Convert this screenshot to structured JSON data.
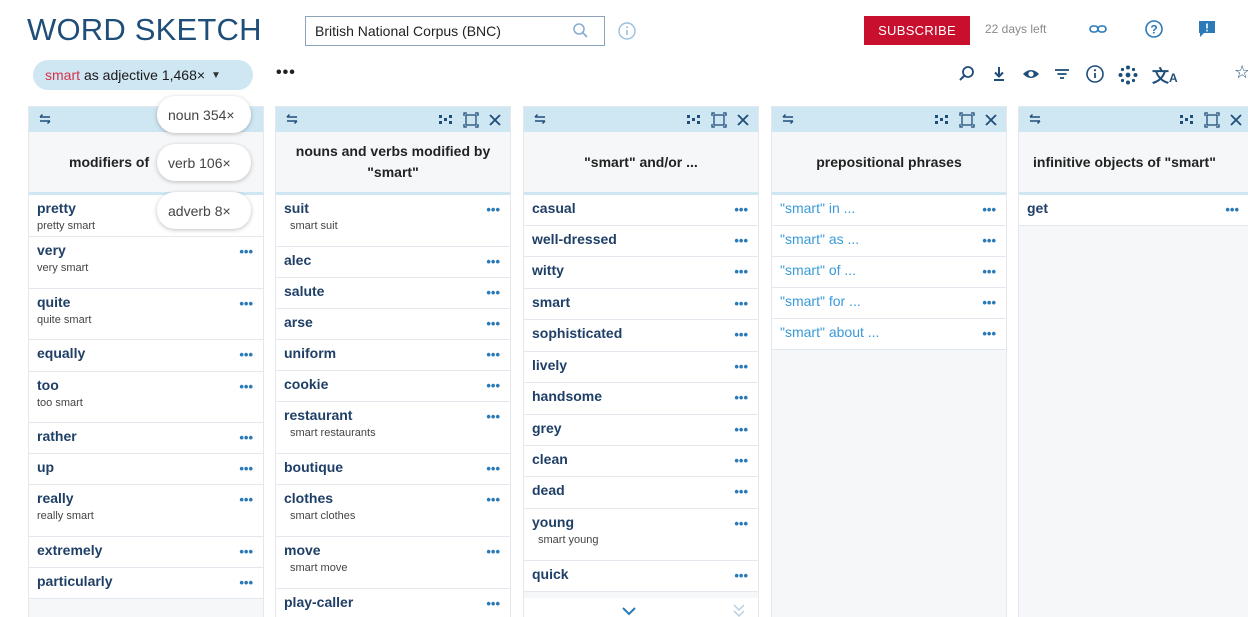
{
  "header": {
    "logo": "WORD SKETCH",
    "corpus": "British National Corpus (BNC)",
    "subscribe": "SUBSCRIBE",
    "days_left": "22 days left"
  },
  "query": {
    "keyword": "smart",
    "rest": "as adjective 1,468×",
    "more": "•••"
  },
  "pos_options": [
    {
      "label": "noun 354×"
    },
    {
      "label": "verb 106×"
    },
    {
      "label": "adverb 8×"
    }
  ],
  "columns": [
    {
      "title": "modifiers of",
      "rows": [
        {
          "w": "pretty",
          "ex": "pretty smart",
          "dots": "•••"
        },
        {
          "w": "very",
          "ex": "very smart",
          "dots": "•••"
        },
        {
          "w": "quite",
          "ex": "quite smart",
          "dots": "•••"
        },
        {
          "w": "equally",
          "ex": "",
          "dots": "•••"
        },
        {
          "w": "too",
          "ex": "too smart",
          "dots": "•••"
        },
        {
          "w": "rather",
          "ex": "",
          "dots": "•••"
        },
        {
          "w": "up",
          "ex": "",
          "dots": "•••"
        },
        {
          "w": "really",
          "ex": "really smart",
          "dots": "•••"
        },
        {
          "w": "extremely",
          "ex": "",
          "dots": "•••"
        },
        {
          "w": "particularly",
          "ex": "",
          "dots": "•••"
        }
      ]
    },
    {
      "title": "nouns and verbs modified by \"smart\"",
      "rows": [
        {
          "w": "suit",
          "ex": "smart suit",
          "dots": "•••"
        },
        {
          "w": "alec",
          "ex": "",
          "dots": "•••"
        },
        {
          "w": "salute",
          "ex": "",
          "dots": "•••"
        },
        {
          "w": "arse",
          "ex": "",
          "dots": "•••"
        },
        {
          "w": "uniform",
          "ex": "",
          "dots": "•••"
        },
        {
          "w": "cookie",
          "ex": "",
          "dots": "•••"
        },
        {
          "w": "restaurant",
          "ex": "smart restaurants",
          "dots": "•••"
        },
        {
          "w": "boutique",
          "ex": "",
          "dots": "•••"
        },
        {
          "w": "clothes",
          "ex": "smart clothes",
          "dots": "•••"
        },
        {
          "w": "move",
          "ex": "smart move",
          "dots": "•••"
        },
        {
          "w": "play-caller",
          "ex": "",
          "dots": "•••"
        }
      ]
    },
    {
      "title": "\"smart\" and/or ...",
      "rows": [
        {
          "w": "casual",
          "ex": "",
          "dots": "•••"
        },
        {
          "w": "well-dressed",
          "ex": "",
          "dots": "•••"
        },
        {
          "w": "witty",
          "ex": "",
          "dots": "•••"
        },
        {
          "w": "smart",
          "ex": "",
          "dots": "•••"
        },
        {
          "w": "sophisticated",
          "ex": "",
          "dots": "•••"
        },
        {
          "w": "lively",
          "ex": "",
          "dots": "•••"
        },
        {
          "w": "handsome",
          "ex": "",
          "dots": "•••"
        },
        {
          "w": "grey",
          "ex": "",
          "dots": "•••"
        },
        {
          "w": "clean",
          "ex": "",
          "dots": "•••"
        },
        {
          "w": "dead",
          "ex": "",
          "dots": "•••"
        },
        {
          "w": "young",
          "ex": "smart young",
          "dots": "•••"
        },
        {
          "w": "quick",
          "ex": "",
          "dots": "•••"
        }
      ]
    },
    {
      "title": "prepositional phrases",
      "rows": [
        {
          "w": "\"smart\" in ...",
          "ex": "",
          "dots": "•••"
        },
        {
          "w": "\"smart\" as ...",
          "ex": "",
          "dots": "•••"
        },
        {
          "w": "\"smart\" of ...",
          "ex": "",
          "dots": "•••"
        },
        {
          "w": "\"smart\" for ...",
          "ex": "",
          "dots": "•••"
        },
        {
          "w": "\"smart\" about ...",
          "ex": "",
          "dots": "•••"
        }
      ]
    },
    {
      "title": "infinitive objects of \"smart\"",
      "rows": [
        {
          "w": "get",
          "ex": "",
          "dots": "•••"
        }
      ]
    }
  ],
  "icons": {
    "search": "search-icon",
    "info": "info-icon",
    "link": "link-icon",
    "help": "help-icon",
    "feedback": "feedback-icon",
    "zoom": "zoom-icon",
    "download": "download-icon",
    "view": "eye-icon",
    "filter": "filter-icon",
    "settings": "dots-grid-icon",
    "translate": "translate-icon",
    "star": "star-icon"
  },
  "colors": {
    "brand": "#1f4e79",
    "accent": "#cfe6f3",
    "subscribe": "#c8102e",
    "keyword": "#d6334a",
    "link": "#3a9ad9"
  }
}
